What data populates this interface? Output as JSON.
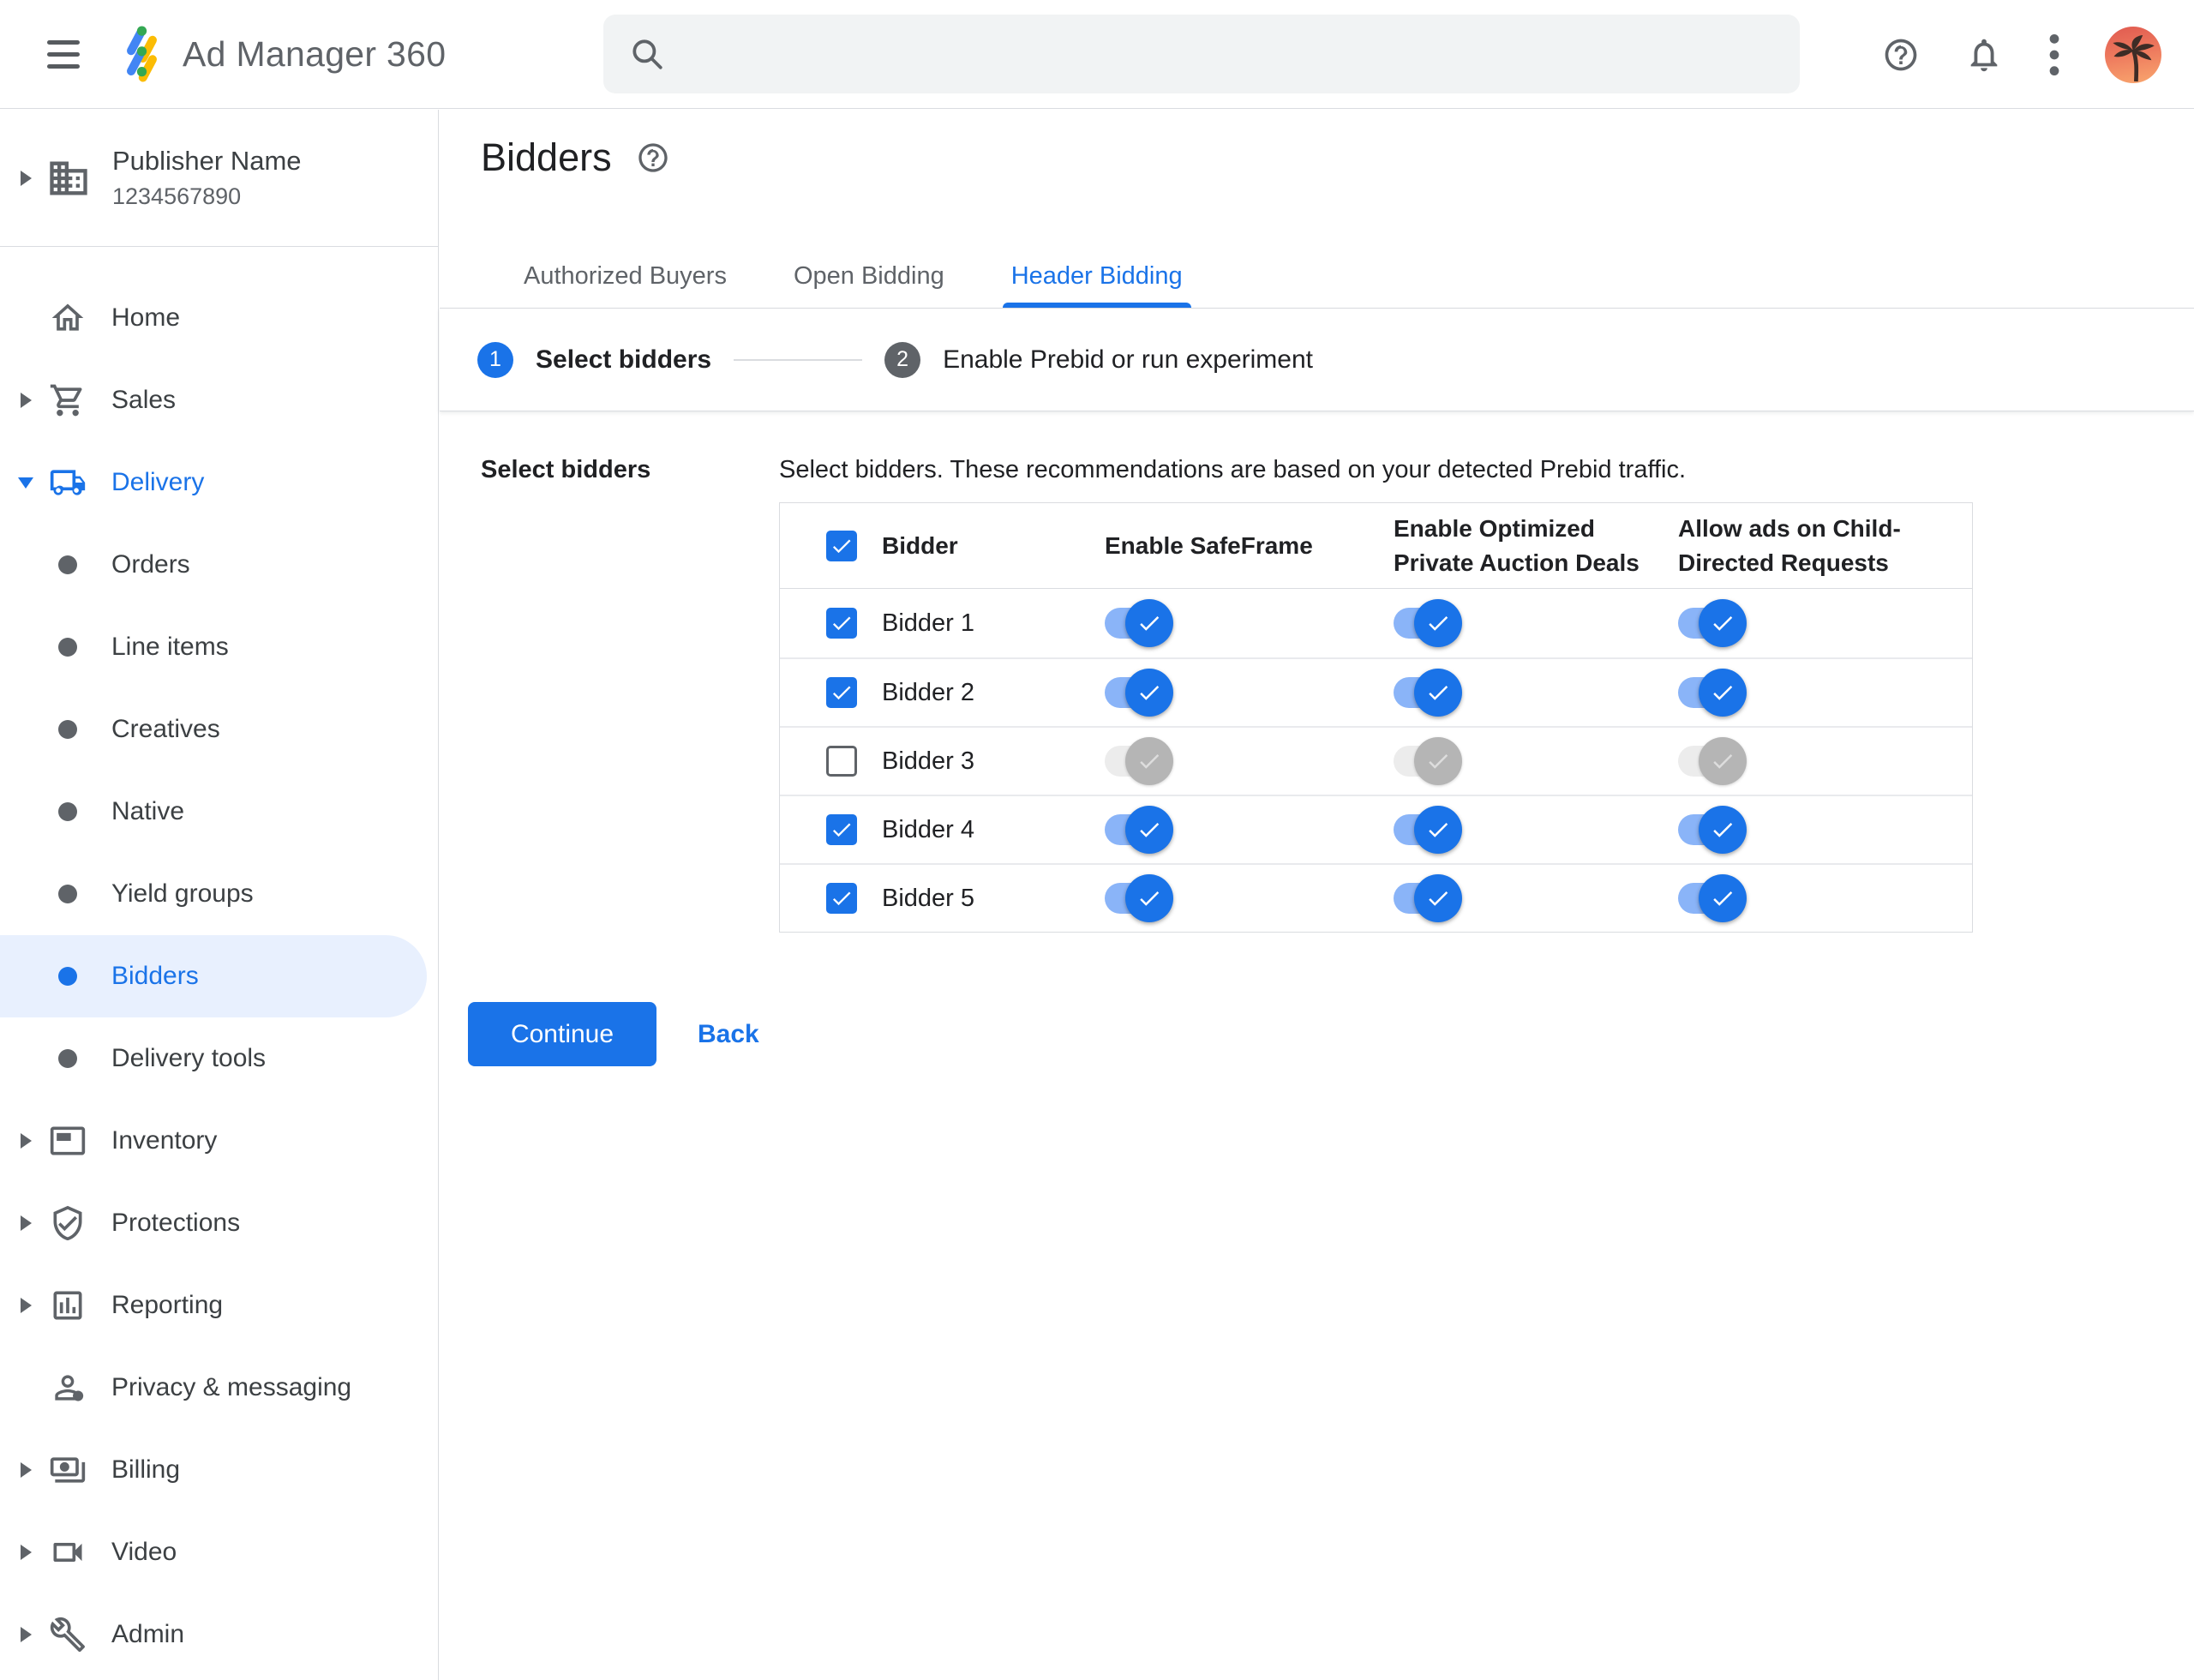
{
  "colors": {
    "accent": "#1a73e8",
    "accent_track": "#8ab4f8",
    "selected_item_bg": "#e8f0fe",
    "text": "#202124",
    "muted": "#5f6368",
    "border": "#dadce0",
    "search_bg": "#f1f3f4"
  },
  "topbar": {
    "app_name": "Ad Manager 360",
    "search": {
      "value": "",
      "placeholder": ""
    },
    "icons": [
      "menu-icon",
      "search-icon",
      "help-icon",
      "notifications-bell-icon",
      "more-options-kebab-icon",
      "avatar-palm-tree"
    ]
  },
  "sidebar": {
    "publisher": {
      "name": "Publisher Name",
      "id": "1234567890"
    },
    "items": [
      {
        "label": "Home"
      },
      {
        "label": "Sales",
        "collapsed": true
      },
      {
        "label": "Delivery",
        "expanded": true,
        "highlighted": true
      },
      {
        "label": "Orders"
      },
      {
        "label": "Line items"
      },
      {
        "label": "Creatives"
      },
      {
        "label": "Native"
      },
      {
        "label": "Yield groups"
      },
      {
        "label": "Bidders",
        "active": true
      },
      {
        "label": "Delivery tools"
      },
      {
        "label": "Inventory",
        "collapsed": true
      },
      {
        "label": "Protections",
        "collapsed": true
      },
      {
        "label": "Reporting",
        "collapsed": true
      },
      {
        "label": "Privacy & messaging"
      },
      {
        "label": "Billing",
        "collapsed": true
      },
      {
        "label": "Video",
        "collapsed": true
      },
      {
        "label": "Admin",
        "collapsed": true
      }
    ]
  },
  "main": {
    "page_title": "Bidders",
    "tabs": [
      {
        "label": "Authorized Buyers",
        "active": false
      },
      {
        "label": "Open Bidding",
        "active": false
      },
      {
        "label": "Header Bidding",
        "active": true
      }
    ],
    "stepper": [
      {
        "number": "1",
        "label": "Select bidders",
        "active": true
      },
      {
        "number": "2",
        "label": "Enable Prebid or run experiment",
        "active": false
      }
    ],
    "section_label": "Select bidders",
    "description": "Select bidders. These recommendations are based on your detected Prebid traffic.",
    "table": {
      "header": {
        "select_all_checked": true,
        "columns": [
          "Bidder",
          "Enable SafeFrame",
          "Enable Optimized Private Auction Deals",
          "Allow ads on Child-Directed Requests"
        ]
      },
      "rows": [
        {
          "name": "Bidder 1",
          "checked": true,
          "enable_safeframe": true,
          "enable_optimized_private_auction_deals": true,
          "allow_ads_child_directed": true
        },
        {
          "name": "Bidder 2",
          "checked": true,
          "enable_safeframe": true,
          "enable_optimized_private_auction_deals": true,
          "allow_ads_child_directed": true
        },
        {
          "name": "Bidder 3",
          "checked": false,
          "enable_safeframe": true,
          "enable_optimized_private_auction_deals": true,
          "allow_ads_child_directed": true
        },
        {
          "name": "Bidder 4",
          "checked": true,
          "enable_safeframe": true,
          "enable_optimized_private_auction_deals": true,
          "allow_ads_child_directed": true
        },
        {
          "name": "Bidder 5",
          "checked": true,
          "enable_safeframe": true,
          "enable_optimized_private_auction_deals": true,
          "allow_ads_child_directed": true
        }
      ]
    },
    "actions": {
      "continue_label": "Continue",
      "back_label": "Back"
    }
  }
}
